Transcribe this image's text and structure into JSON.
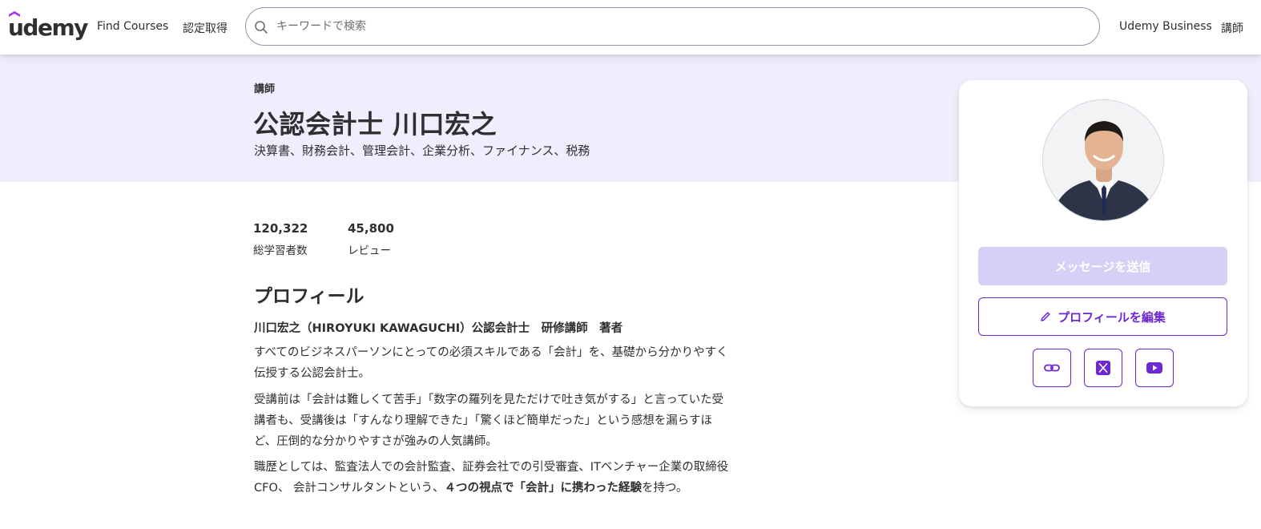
{
  "header": {
    "logo_text": "udemy",
    "nav": {
      "find_courses": "Find Courses",
      "certification": "認定取得",
      "business": "Udemy Business",
      "instructor": "講師"
    },
    "search": {
      "placeholder": "キーワードで検索",
      "value": ""
    },
    "colors": {
      "brand": "#a435f0",
      "text": "#2d2f31"
    }
  },
  "profile": {
    "eyebrow": "講師",
    "name": "公認会計士 川口宏之",
    "headline": "決算書、財務会計、管理会計、企業分析、ファイナンス、税務",
    "stats": [
      {
        "value": "120,322",
        "label": "総学習者数"
      },
      {
        "value": "45,800",
        "label": "レビュー"
      }
    ],
    "section_title": "プロフィール",
    "bio_lead": "川口宏之（HIROYUKI KAWAGUCHI）公認会計士　研修講師　著者",
    "bio_1": "すべてのビジネスパーソンにとっての必須スキルである「会計」を、基礎から分かりやすく伝授する公認会計士。",
    "bio_2": "受講前は「会計は難しくて苦手」「数字の羅列を見ただけで吐き気がする」と言っていた受講者も、受講後は「すんなり理解できた」「驚くほど簡単だった」という感想を漏らすほど、圧倒的な分かりやすさが強みの人気講師。",
    "bio_3_prefix": "職歴としては、監査法人での会計監査、証券会社での引受審査、ITベンチャー企業の取締役CFO、 会計コンサルタントという、",
    "bio_3_bold": "４つの視点で「会計」に携わった経験",
    "bio_3_suffix": "を持つ。"
  },
  "card": {
    "avatar_icon": "instructor-avatar",
    "message_button": "メッセージを送信",
    "edit_button": "プロフィールを編集",
    "socials": [
      "link-icon",
      "x-icon",
      "youtube-icon"
    ],
    "colors": {
      "primary": "#6d28d2",
      "disabled": "#d8cff7"
    }
  }
}
